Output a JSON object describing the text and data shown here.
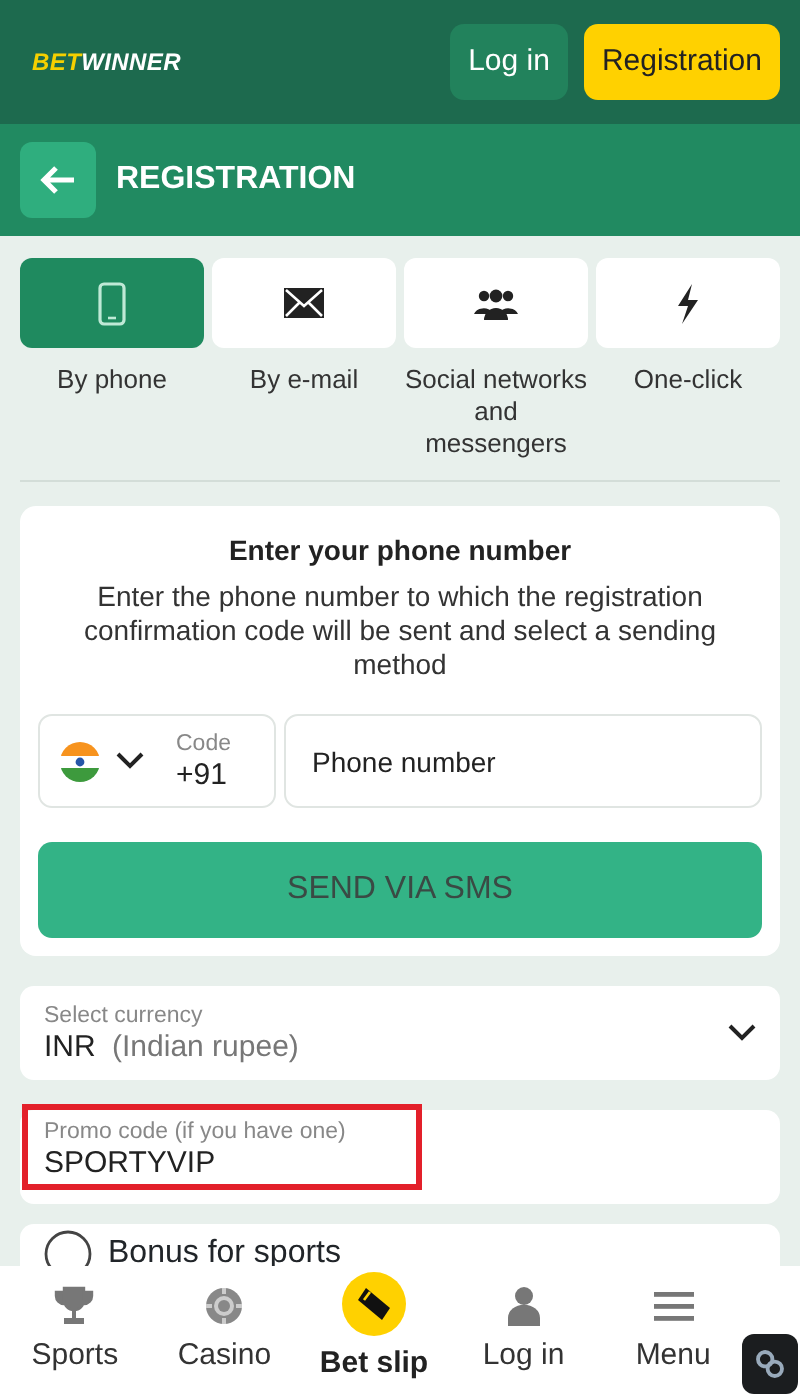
{
  "header": {
    "logo_parts": [
      "BET",
      "WINNER"
    ],
    "buttons": [
      {
        "label": "Log in",
        "kind": "secondary"
      },
      {
        "label": "Registration",
        "kind": "primary"
      }
    ]
  },
  "title": "REGISTRATION",
  "methods": [
    {
      "label": "By phone",
      "kind": "phone",
      "selected": true
    },
    {
      "label": "By e-mail",
      "kind": "mail",
      "selected": false
    },
    {
      "label": "Social networks and messengers",
      "kind": "people",
      "selected": false
    },
    {
      "label": "One-click",
      "kind": "bolt",
      "selected": false
    }
  ],
  "phone_card": {
    "heading": "Enter your phone number",
    "description": "Enter the phone number to which the registration confirmation code will be sent and select a sending method",
    "code_label": "Code",
    "code_value": "+91",
    "phone_placeholder": "Phone number",
    "send_button": "SEND VIA SMS"
  },
  "currency": {
    "label": "Select currency",
    "code": "INR",
    "name": "(Indian rupee)"
  },
  "promo": {
    "label": "Promo code (if you have one)",
    "value": "SPORTYVIP",
    "highlighted": true
  },
  "bonus": {
    "label": "Bonus for sports"
  },
  "bottom_nav": [
    {
      "label": "Sports",
      "kind": "trophy",
      "selected": false
    },
    {
      "label": "Casino",
      "kind": "chip",
      "selected": false
    },
    {
      "label": "Bet slip",
      "kind": "ticket",
      "selected": true
    },
    {
      "label": "Log in",
      "kind": "user",
      "selected": false
    },
    {
      "label": "Menu",
      "kind": "menu",
      "selected": false
    }
  ]
}
